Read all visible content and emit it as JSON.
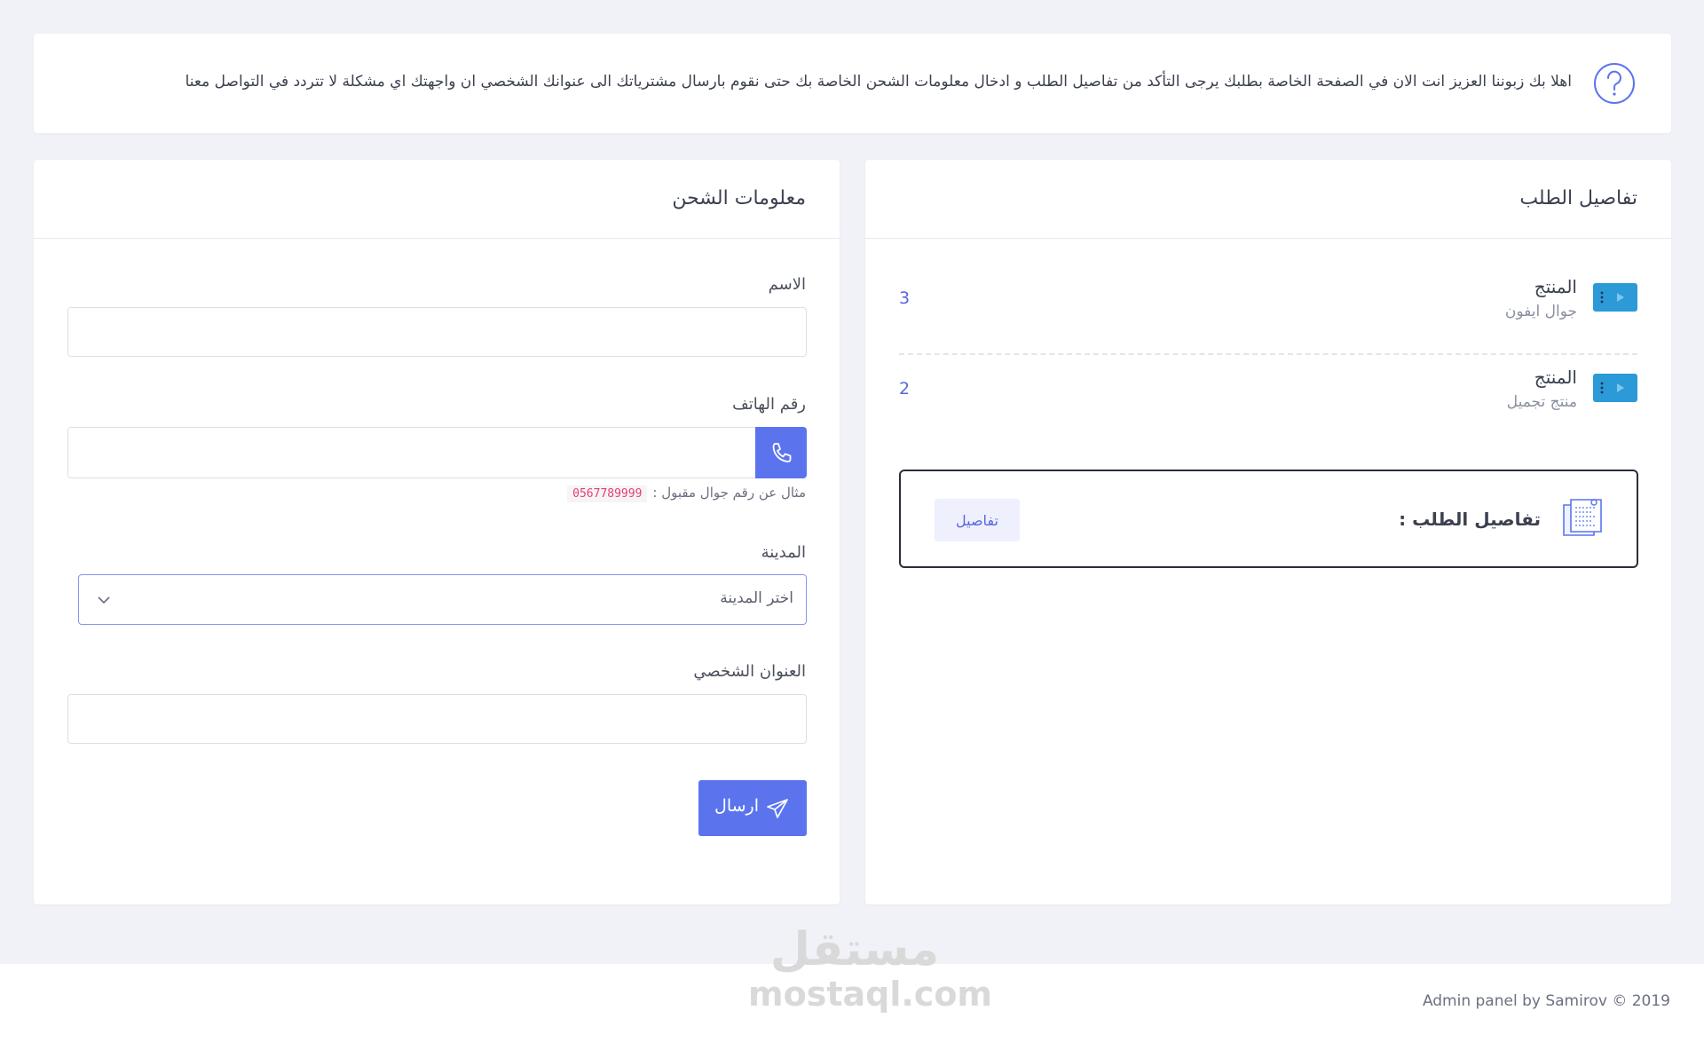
{
  "alert": {
    "text": "اهلا بك زبوننا العزيز انت الان في الصفحة الخاصة بطلبك يرجى التأكد من تفاصيل الطلب و ادخال معلومات الشحن الخاصة بك حتى نقوم بارسال مشترياتك الى عنوانك الشخصي ان واجهتك اي مشكلة لا تتردد في التواصل معنا",
    "icon": "question-circle-icon"
  },
  "order": {
    "title": "تفاصيل الطلب",
    "items": [
      {
        "label": "المنتج",
        "name": "جوال ايفون",
        "quantity": "3"
      },
      {
        "label": "المنتج",
        "name": "منتج تجميل",
        "quantity": "2"
      }
    ],
    "summary": {
      "title": "تفاصيل الطلب :",
      "button_label": "تفاصيل"
    }
  },
  "shipping": {
    "title": "معلومات الشحن",
    "name_label": "الاسم",
    "phone_label": "رقم الهاتف",
    "phone_hint": "مثال عن رقم جوال مقبول :",
    "phone_example": "0567789999",
    "city_label": "المدينة",
    "city_selected": "اختر المدينة",
    "address_label": "العنوان الشخصي",
    "submit_label": "ارسال"
  },
  "footer": {
    "copyright": "Admin panel by Samirov © 2019"
  },
  "watermark": {
    "arabic": "مستقل",
    "latin": "mostaql.com"
  },
  "colors": {
    "accent": "#5b74ee",
    "tag": "#2b9ad7",
    "background": "#f1f2f7"
  }
}
